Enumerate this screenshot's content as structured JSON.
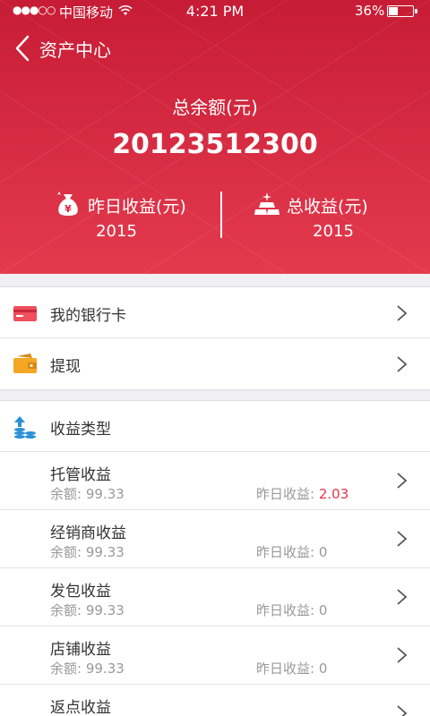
{
  "status_bar": {
    "signal": "●●●○○",
    "carrier": "中国移动",
    "time": "4:21 PM",
    "battery": "36%",
    "battery_level": 0.36
  },
  "nav": {
    "title": "资产中心",
    "back_icon": "chevron-left-icon"
  },
  "summary": {
    "total_label": "总余额(元)",
    "total_amount": "20123512300",
    "yesterday": {
      "label": "昨日收益(元)",
      "value": "2015",
      "icon": "money-bag-icon"
    },
    "total_earnings": {
      "label": "总收益(元)",
      "value": "2015",
      "icon": "gold-bars-icon"
    }
  },
  "menu": [
    {
      "label": "我的银行卡",
      "icon": "bank-card-icon"
    },
    {
      "label": "提现",
      "icon": "wallet-icon"
    }
  ],
  "earnings_types": {
    "title": "收益类型",
    "icon": "coins-up-icon",
    "balance_prefix": "余额:",
    "yesterday_prefix": "昨日收益:",
    "items": [
      {
        "name": "托管收益",
        "balance": "99.33",
        "yesterday": "2.03"
      },
      {
        "name": "经销商收益",
        "balance": "99.33",
        "yesterday": "0"
      },
      {
        "name": "发包收益",
        "balance": "99.33",
        "yesterday": "0"
      },
      {
        "name": "店铺收益",
        "balance": "99.33",
        "yesterday": "0"
      },
      {
        "name": "返点收益",
        "balance": "",
        "yesterday": ""
      }
    ]
  },
  "colors": {
    "header_top": "#c71c35",
    "header_bottom": "#e43a4e",
    "positive": "#e2354a"
  }
}
